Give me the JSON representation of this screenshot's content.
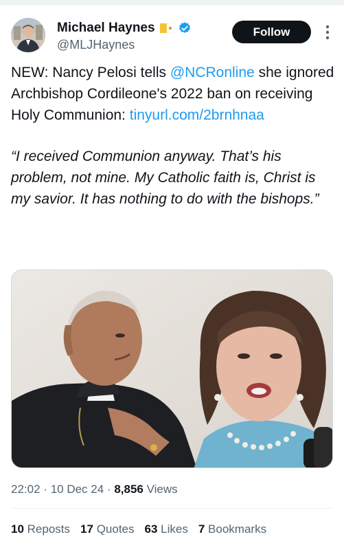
{
  "author": {
    "display_name": "Michael Haynes",
    "handle": "@MLJHaynes",
    "badge_icons": [
      "vatican-flag-icon",
      "verified-badge-icon"
    ],
    "verified_color": "#1d9bf0"
  },
  "follow_button": {
    "label": "Follow",
    "bg": "#0f1419",
    "fg": "#ffffff"
  },
  "more_menu_icon": "more-vertical-icon",
  "tweet": {
    "text_parts": [
      "NEW: Nancy Pelosi tells ",
      "@NCRonline",
      " she ignored Archbishop Cordileone's 2022 ban on receiving Holy Communion: ",
      "tinyurl.com/2brnhnaa"
    ],
    "quote": "“I received Communion anyway. That’s his problem, not mine. My Catholic faith is, Christ is my savior. It has nothing to do with the bishops.”",
    "link_color": "#1d9bf0"
  },
  "media": {
    "description_icons": [
      "archbishop-photo",
      "pelosi-photo"
    ]
  },
  "meta": {
    "time": "22:02",
    "date": "10 Dec 24",
    "views_count": "8,856",
    "views_label": "Views",
    "separator": "·"
  },
  "stats": [
    {
      "count": "10",
      "label": "Reposts"
    },
    {
      "count": "17",
      "label": "Quotes"
    },
    {
      "count": "63",
      "label": "Likes"
    },
    {
      "count": "7",
      "label": "Bookmarks"
    }
  ]
}
